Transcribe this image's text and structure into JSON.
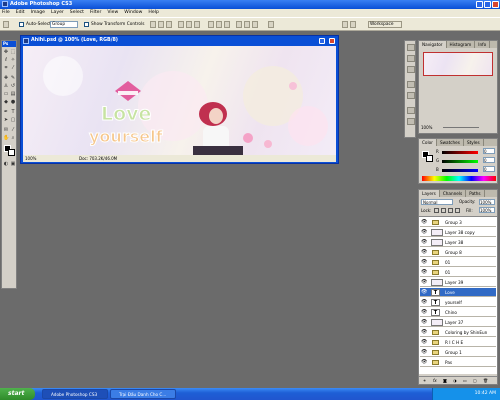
{
  "window": {
    "title": "Adobe Photoshop CS3"
  },
  "menubar": [
    "File",
    "Edit",
    "Image",
    "Layer",
    "Select",
    "Filter",
    "View",
    "Window",
    "Help"
  ],
  "options": {
    "auto_select_label": "Auto-Select",
    "auto_select_value": "Group",
    "show_transform_label": "Show Transform Controls",
    "workspace_label": "Workspace"
  },
  "toolbox": {
    "label": "Ps"
  },
  "document": {
    "title": "Ahihi.psd @ 100% (Love, RGB/8)",
    "zoom": "100%",
    "doc_info": "Doc: 703.2K/46.0M",
    "art_text_line1": "Love",
    "art_text_line2": "yourself"
  },
  "navigator": {
    "tabs": [
      "Navigator",
      "Histogram",
      "Info"
    ],
    "zoom": "100%"
  },
  "color_panel": {
    "tabs": [
      "Color",
      "Swatches",
      "Styles"
    ],
    "channels": [
      "R",
      "G",
      "B"
    ],
    "values": [
      "0",
      "0",
      "0"
    ]
  },
  "layers_panel": {
    "tabs": [
      "Layers",
      "Channels",
      "Paths"
    ],
    "blend_mode": "Normal",
    "opacity_label": "Opacity:",
    "opacity_value": "100%",
    "lock_label": "Lock:",
    "fill_label": "Fill:",
    "fill_value": "100%",
    "layers": [
      {
        "name": "Group 3",
        "kind": "folder",
        "selected": false
      },
      {
        "name": "Layer 38 copy",
        "kind": "image",
        "selected": false
      },
      {
        "name": "Layer 38",
        "kind": "image",
        "selected": false
      },
      {
        "name": "Group 8",
        "kind": "folder",
        "selected": false
      },
      {
        "name": "01",
        "kind": "folder",
        "selected": false
      },
      {
        "name": "01",
        "kind": "folder",
        "selected": false
      },
      {
        "name": "Layer 39",
        "kind": "image",
        "selected": false
      },
      {
        "name": "Love",
        "kind": "text",
        "selected": true
      },
      {
        "name": "yourself",
        "kind": "text",
        "selected": false
      },
      {
        "name": "Chino",
        "kind": "text",
        "selected": false
      },
      {
        "name": "Layer 37",
        "kind": "image",
        "selected": false
      },
      {
        "name": "Coloring by ShinEun",
        "kind": "folder",
        "selected": false
      },
      {
        "name": "R I C H E",
        "kind": "folder",
        "selected": false
      },
      {
        "name": "Group 1",
        "kind": "folder",
        "selected": false
      },
      {
        "name": "Pas",
        "kind": "folder",
        "selected": false
      }
    ]
  },
  "taskbar": {
    "start_label": "start",
    "items": [
      "Adobe Photoshop CS3",
      "Trại Đấu Danh Cho C..."
    ],
    "clock": "10:42 AM"
  },
  "colors": {
    "xp_blue": "#0a4fd6",
    "selection_blue": "#316ac5",
    "workspace_gray": "#6b6b6b",
    "panel_gray": "#d4d0c8",
    "love_text": "#c7e3a2",
    "accent_pink": "#e1458f"
  },
  "icons": [
    "photoshop-app-icon",
    "move-tool-icon",
    "eye-icon",
    "folder-icon",
    "lock-icon",
    "fx-icon",
    "trash-icon"
  ]
}
